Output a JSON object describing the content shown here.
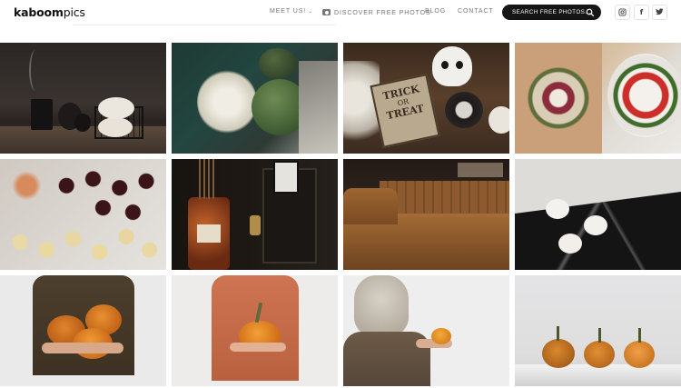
{
  "header": {
    "logo_part1": "kaboom",
    "logo_part2": "pics",
    "nav": {
      "meet_us": "MEET US!",
      "discover": "DISCOVER FREE PHOTOS",
      "blog": "BLOG",
      "contact": "CONTACT"
    },
    "search_label": "SEARCH FREE PHOTOS...",
    "social": {
      "instagram": "instagram-icon",
      "facebook": "f",
      "twitter": "twitter-icon"
    }
  },
  "sign": {
    "line1": "TRICK",
    "line2": "OR",
    "line3": "TREAT"
  },
  "gallery": {
    "photos": [
      "dark-pumpkins-candle",
      "green-pumpkins-flowers",
      "trick-or-treat-skull",
      "charcuterie-caprese",
      "wine-and-desserts",
      "wine-bottle-cabinet",
      "brown-velvet-sofa",
      "white-pumpkins-marble",
      "woman-holding-two-pumpkins",
      "woman-holding-one-pumpkin",
      "woman-with-small-pumpkin",
      "three-pumpkins-shelf"
    ]
  }
}
